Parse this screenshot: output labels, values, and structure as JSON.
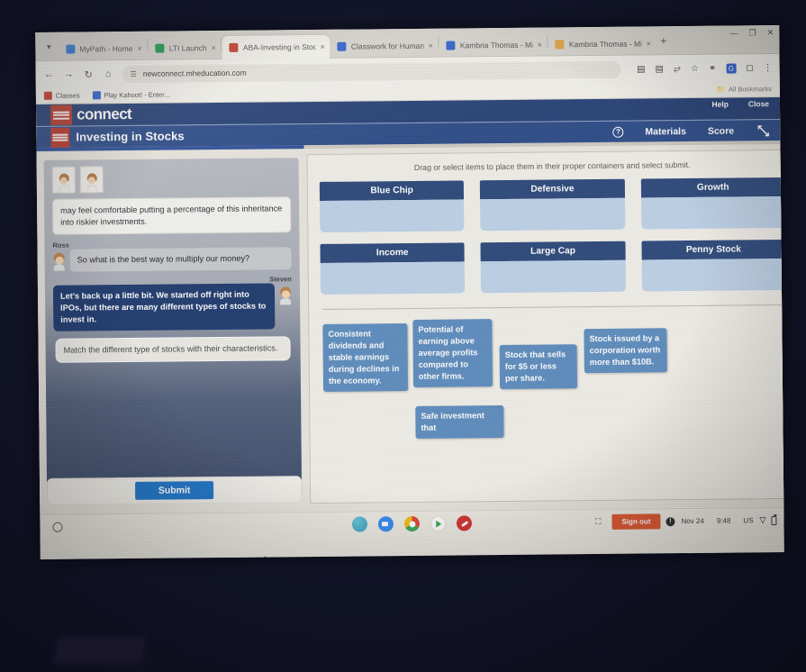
{
  "browser": {
    "tabs": [
      {
        "label": "MyPath - Home",
        "favicon": "#2b7de0",
        "active": false,
        "close": "×"
      },
      {
        "label": "LTI Launch",
        "favicon": "#1a9c4e",
        "active": false,
        "close": "×"
      },
      {
        "label": "ABA-Investing in Stoc",
        "favicon": "#d33b2c",
        "active": true,
        "close": "×"
      },
      {
        "label": "Classwork for Human",
        "favicon": "#2f63d8",
        "active": false,
        "close": "×"
      },
      {
        "label": "Kambria Thomas - Mi",
        "favicon": "#2f63d8",
        "active": false,
        "close": "×"
      },
      {
        "label": "Kambria Thomas - Mi",
        "favicon": "#e8a33d",
        "active": false,
        "close": "×"
      }
    ],
    "new_tab_label": "+",
    "window_controls": {
      "minimize": "—",
      "maximize": "❐",
      "close": "✕"
    },
    "nav": {
      "back": "←",
      "forward": "→",
      "reload": "↻",
      "home": "⌂"
    },
    "url": "newconnect.mheducation.com",
    "url_icon": "tune-icon",
    "omnibox_actions": [
      "split-screen-icon",
      "tab-grid-icon",
      "share-icon",
      "bookmark-star-icon",
      "extensions-icon",
      "grammarly-icon",
      "profile-icon",
      "menu-icon"
    ],
    "bookmarks": [
      {
        "label": "Classes",
        "color": "#d33b2c"
      },
      {
        "label": "Play Kahoot! - Enter...",
        "color": "#2f63d8"
      }
    ],
    "bookmarks_right": "All Bookmarks"
  },
  "connect": {
    "brand": "connect",
    "brand_mark": "mcgraw-hill-logo",
    "help_label": "Help",
    "close_label": "Close",
    "lesson_title": "Investing in Stocks",
    "materials_label": "Materials",
    "score_label": "Score",
    "help_circle_icon": "question-circle-icon",
    "expand_icon": "expand-arrows-icon",
    "progress_percent": 36
  },
  "conversation": {
    "messages": [
      {
        "speaker": "",
        "speaker_align": "left",
        "style": "white",
        "text": "may feel comfortable putting a percentage of this inheritance into riskier investments."
      },
      {
        "speaker": "Ross",
        "speaker_align": "left",
        "style": "grey",
        "text": "So what is the best way to multiply our money?"
      },
      {
        "speaker": "Steven",
        "speaker_align": "right",
        "style": "navy",
        "text": "Let's back up a little bit. We started off right into IPOs, but there are many different types of stocks to invest in."
      },
      {
        "speaker": "",
        "speaker_align": "left",
        "style": "prompt",
        "text": "Match the different type of stocks with their characteristics."
      }
    ],
    "submit_label": "Submit"
  },
  "activity": {
    "instruction": "Drag or select items to place them in their proper containers and select submit.",
    "bins": [
      {
        "label": "Blue Chip",
        "contents": []
      },
      {
        "label": "Defensive",
        "contents": []
      },
      {
        "label": "Growth",
        "contents": []
      },
      {
        "label": "Income",
        "contents": []
      },
      {
        "label": "Large Cap",
        "contents": []
      },
      {
        "label": "Penny Stock",
        "contents": []
      }
    ],
    "tokens": [
      {
        "text": "Consistent dividends and stable earnings during declines in the economy."
      },
      {
        "text": "Potential of earning above average profits compared to other firms."
      },
      {
        "text": "Stock that sells for $5 or less per share."
      },
      {
        "text": "Stock issued by a corporation worth more than $10B."
      },
      {
        "text": "Safe investment that"
      }
    ]
  },
  "shelf": {
    "launcher_icon": "launcher-circle-icon",
    "apps": [
      {
        "name": "teal-app-icon"
      },
      {
        "name": "zoom-icon"
      },
      {
        "name": "chrome-icon"
      },
      {
        "name": "play-store-icon"
      },
      {
        "name": "red-app-icon"
      }
    ],
    "screenshot_icon": "screen-capture-icon",
    "sign_out_label": "Sign out",
    "notification_icon": "notification-dot-icon",
    "date": "Nov 24",
    "time": "9:48",
    "locale": "US",
    "wifi_icon": "wifi-icon",
    "battery_icon": "battery-icon"
  },
  "colors": {
    "connect_navy": "#26427c",
    "title_navy": "#2b4d8e",
    "bin_header": "#2b4a80",
    "bin_body": "#bdd2ea",
    "token_blue": "#5b8ec4",
    "submit_blue": "#1877d2",
    "signout_orange": "#e8542a",
    "mcgraw_red": "#c0392b"
  }
}
